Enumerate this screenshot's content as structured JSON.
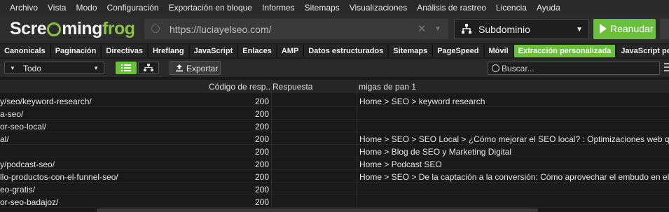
{
  "menu": [
    "Archivo",
    "Vista",
    "Modo",
    "Configuración",
    "Exportación en bloque",
    "Informes",
    "Sitemaps",
    "Visualizaciones",
    "Análisis de rastreo",
    "Licencia",
    "Ayuda"
  ],
  "logo": {
    "scre": "Scre",
    "o": "",
    "ming": "ming",
    "frog": "frog",
    "full": "Screaming frog"
  },
  "url": {
    "value": "https://luciayelseo.com/"
  },
  "mode": {
    "label": "Subdominio"
  },
  "resume": {
    "label": "Reanudar"
  },
  "tabs": [
    "Canonicals",
    "Paginación",
    "Directivas",
    "Hreflang",
    "JavaScript",
    "Enlaces",
    "AMP",
    "Datos estructurados",
    "Sitemaps",
    "PageSpeed",
    "Móvil",
    "Extracción personalizada",
    "JavaScript personalizado"
  ],
  "filter": {
    "value": "Todo"
  },
  "export": {
    "label": "Exportar"
  },
  "search": {
    "placeholder": "Buscar..."
  },
  "columns": {
    "status": "Código de resp...",
    "response": "Respuesta",
    "breadcrumb": "migas de pan 1"
  },
  "rows": [
    {
      "address": "y/seo/keyword-research/",
      "status": "200",
      "response": "",
      "breadcrumb": "Home > SEO  > keyword research"
    },
    {
      "address": "a-seo/",
      "status": "200",
      "response": "",
      "breadcrumb": ""
    },
    {
      "address": "or-seo-local/",
      "status": "200",
      "response": "",
      "breadcrumb": ""
    },
    {
      "address": "al/",
      "status": "200",
      "response": "",
      "breadcrumb": "Home > SEO  > SEO Local  > ¿Cómo mejorar el SEO local? : Optimizaciones web que debes l"
    },
    {
      "address": "",
      "status": "200",
      "response": "",
      "breadcrumb": " Home >  Blog de SEO y Marketing Digital"
    },
    {
      "address": "y/podcast-seo/",
      "status": "200",
      "response": "",
      "breadcrumb": "Home > Podcast SEO"
    },
    {
      "address": "llo-productos-con-el-funnel-seo/",
      "status": "200",
      "response": "",
      "breadcrumb": " Home > SEO  > De la captación a la conversión: Cómo aprovechar el embudo en el desarrol"
    },
    {
      "address": "eo-gratis/",
      "status": "200",
      "response": "",
      "breadcrumb": ""
    },
    {
      "address": "or-seo-badajoz/",
      "status": "200",
      "response": "",
      "breadcrumb": ""
    }
  ],
  "colors": {
    "accent": "#6abf3d",
    "background": "#1a1a1a"
  }
}
